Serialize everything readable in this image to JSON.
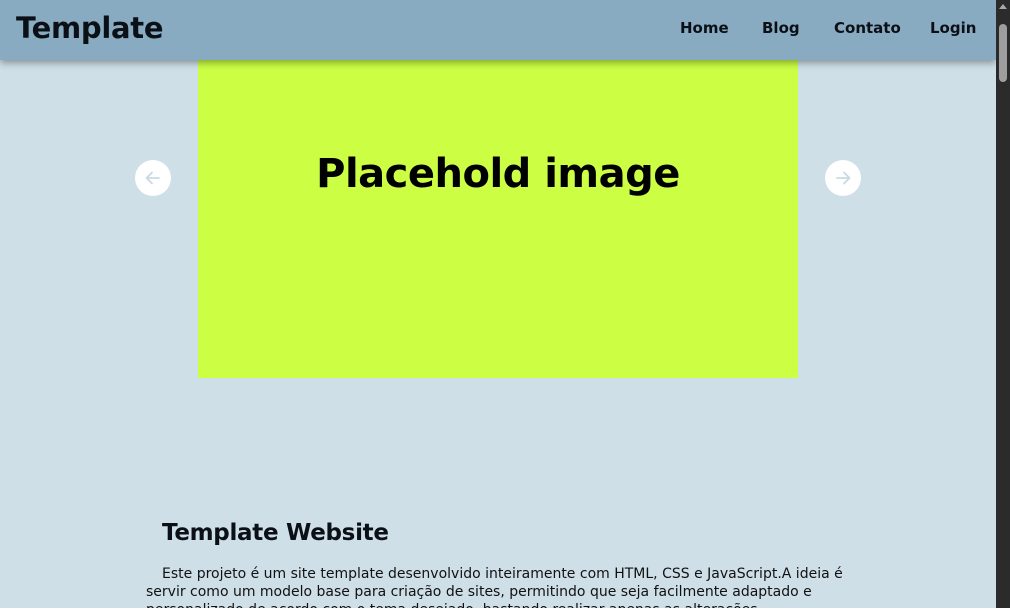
{
  "header": {
    "brand": "Template",
    "nav": [
      "Home",
      "Blog",
      "Contato",
      "Login"
    ]
  },
  "carousel": {
    "slide_text": "Placehold image",
    "prev_icon": "arrow-left-icon",
    "next_icon": "arrow-right-icon",
    "slide_color": "#ccff44"
  },
  "article": {
    "title": "Template Website",
    "body": "Este projeto é um site template desenvolvido inteiramente com HTML, CSS e JavaScript.A ideia é servir como um modelo base para criação de sites, permitindo que seja facilmente adaptado e personalizado de acordo com o tema desejado, bastando realizar apenas as alterações"
  },
  "colors": {
    "background": "#cfdfe8",
    "header": "#89abc2",
    "accent": "#ccff44"
  }
}
